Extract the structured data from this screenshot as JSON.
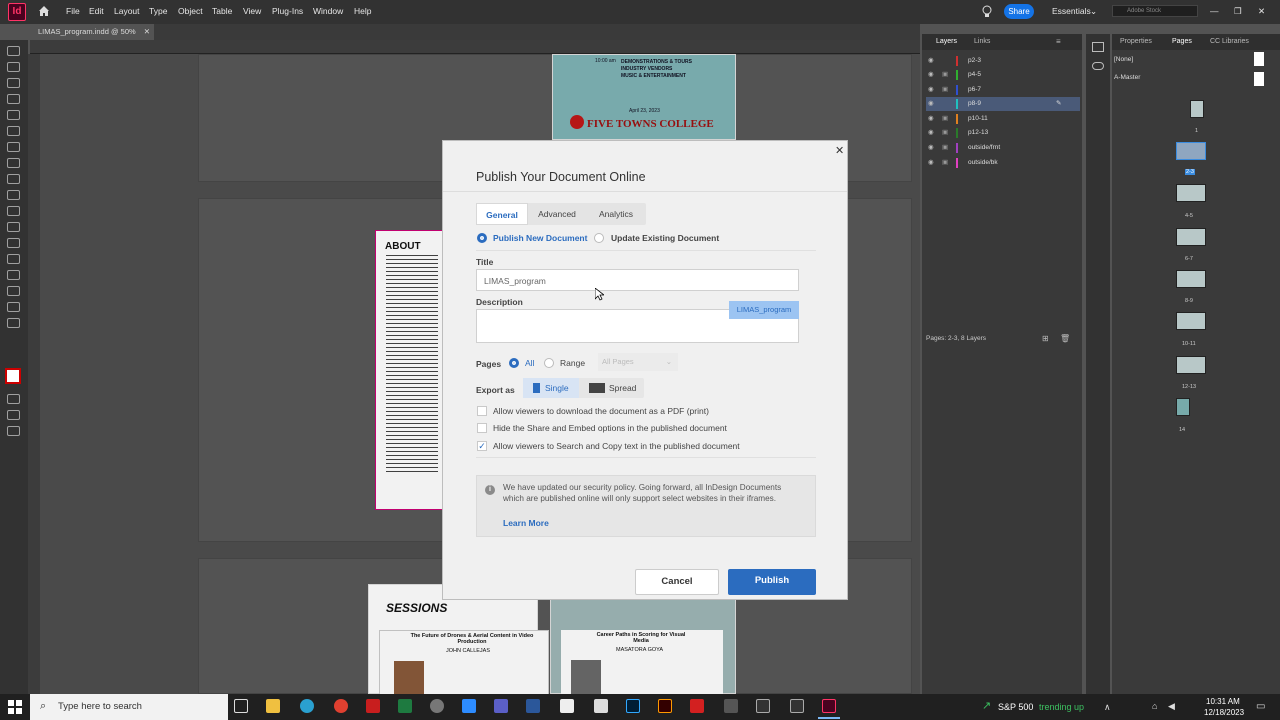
{
  "app": {
    "logo": "Id",
    "share_label": "Share",
    "workspace": "Essentials",
    "stock_placeholder": "Adobe Stock"
  },
  "menu": [
    "File",
    "Edit",
    "Layout",
    "Type",
    "Object",
    "Table",
    "View",
    "Plug-Ins",
    "Window",
    "Help"
  ],
  "document_tab": "LIMAS_program.indd @ 50%",
  "canvas": {
    "flyer_lines": [
      "DEMONSTRATIONS & TOURS",
      "INDUSTRY VENDORS",
      "MUSIC & ENTERTAINMENT"
    ],
    "flyer_time": "10:00 am",
    "flyer_date": "April 23, 2023",
    "college": "FIVE TOWNS COLLEGE",
    "about_heading": "ABOUT",
    "sessions_heading": "SESSIONS",
    "session1_title": "The Future of Drones & Aerial Content in Video Production",
    "session1_speaker": "JOHN CALLEJAS",
    "session2_title": "Career Paths in Scoring for Visual Media",
    "session2_speaker": "MASATORA GOYA"
  },
  "layers_panel": {
    "tabs": [
      "Layers",
      "Links"
    ],
    "layers": [
      {
        "name": "p2-3",
        "color": "#d03030"
      },
      {
        "name": "p4-5",
        "color": "#30b030"
      },
      {
        "name": "p6-7",
        "color": "#3050d0"
      },
      {
        "name": "p8-9",
        "color": "#20c0c0"
      },
      {
        "name": "p10-11",
        "color": "#e08020"
      },
      {
        "name": "p12-13",
        "color": "#2a7a2a"
      },
      {
        "name": "outside/frnt",
        "color": "#a040c0"
      },
      {
        "name": "outside/bk",
        "color": "#e040c0"
      }
    ],
    "status": "Pages: 2-3, 8 Layers"
  },
  "pages_panel": {
    "tabs": [
      "Properties",
      "Pages",
      "CC Libraries"
    ],
    "masters": [
      "[None]",
      "A-Master"
    ],
    "page_labels": [
      "1",
      "2-3",
      "4-5",
      "6-7",
      "8-9",
      "10-11",
      "12-13",
      "14"
    ]
  },
  "dialog": {
    "title": "Publish Your Document Online",
    "tabs": [
      "General",
      "Advanced",
      "Analytics"
    ],
    "mode_new": "Publish New Document",
    "mode_update": "Update Existing Document",
    "title_label": "Title",
    "title_value": "LIMAS_program",
    "description_label": "Description",
    "drag_ghost": "LIMAS_program",
    "pages_label": "Pages",
    "pages_all": "All",
    "pages_range": "Range",
    "pages_select": "All Pages",
    "export_label": "Export as",
    "export_single": "Single",
    "export_spread": "Spread",
    "opt_pdf": "Allow viewers to download the document as a PDF (print)",
    "opt_share": "Hide the Share and Embed options in the published document",
    "opt_search": "Allow viewers to Search and Copy text in the published document",
    "notice": "We have updated our security policy. Going forward, all InDesign Documents which are published online will only support select websites in their iframes.",
    "learn_more": "Learn More",
    "cancel": "Cancel",
    "publish": "Publish"
  },
  "taskbar": {
    "search_placeholder": "Type here to search",
    "stock_name": "S&P 500",
    "stock_status": "trending up",
    "time": "10:31 AM",
    "date": "12/18/2023"
  }
}
